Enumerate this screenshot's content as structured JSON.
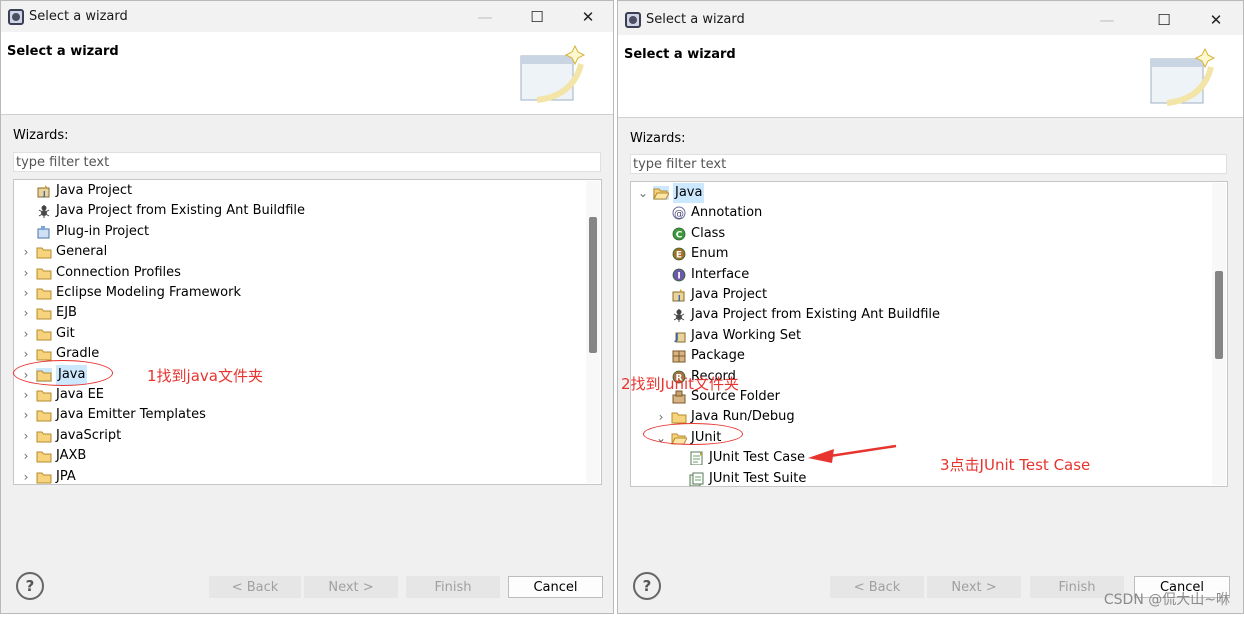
{
  "dialogs": [
    {
      "window_title": "Select a wizard",
      "header_title": "Select a wizard",
      "wizards_label": "Wizards:",
      "filter_placeholder": "type filter text",
      "buttons": {
        "back": "< Back",
        "next": "Next >",
        "finish": "Finish",
        "cancel": "Cancel"
      },
      "help": "?",
      "tree": [
        {
          "label": "Java Project",
          "icon": "java-project-icon",
          "level": 1,
          "expander": ""
        },
        {
          "label": "Java Project from Existing Ant Buildfile",
          "icon": "ant-icon",
          "level": 1,
          "expander": ""
        },
        {
          "label": "Plug-in Project",
          "icon": "plugin-project-icon",
          "level": 1,
          "expander": ""
        },
        {
          "label": "General",
          "icon": "folder-icon",
          "level": 0,
          "expander": "›"
        },
        {
          "label": "Connection Profiles",
          "icon": "folder-icon",
          "level": 0,
          "expander": "›"
        },
        {
          "label": "Eclipse Modeling Framework",
          "icon": "folder-icon",
          "level": 0,
          "expander": "›"
        },
        {
          "label": "EJB",
          "icon": "folder-icon",
          "level": 0,
          "expander": "›"
        },
        {
          "label": "Git",
          "icon": "folder-icon",
          "level": 0,
          "expander": "›"
        },
        {
          "label": "Gradle",
          "icon": "folder-icon",
          "level": 0,
          "expander": "›"
        },
        {
          "label": "Java",
          "icon": "folder-icon",
          "level": 0,
          "expander": "›",
          "selected": true
        },
        {
          "label": "Java EE",
          "icon": "folder-icon",
          "level": 0,
          "expander": "›"
        },
        {
          "label": "Java Emitter Templates",
          "icon": "folder-icon",
          "level": 0,
          "expander": "›"
        },
        {
          "label": "JavaScript",
          "icon": "folder-icon",
          "level": 0,
          "expander": "›"
        },
        {
          "label": "JAXB",
          "icon": "folder-icon",
          "level": 0,
          "expander": "›"
        },
        {
          "label": "JPA",
          "icon": "folder-icon",
          "level": 0,
          "expander": "›"
        }
      ],
      "annotation": "1找到java文件夹"
    },
    {
      "window_title": "Select a wizard",
      "header_title": "Select a wizard",
      "wizards_label": "Wizards:",
      "filter_placeholder": "type filter text",
      "buttons": {
        "back": "< Back",
        "next": "Next >",
        "finish": "Finish",
        "cancel": "Cancel"
      },
      "help": "?",
      "tree": [
        {
          "label": "Java",
          "icon": "folder-open-icon",
          "level": 0,
          "expander": "⌄",
          "selected": true
        },
        {
          "label": "Annotation",
          "icon": "annotation-icon",
          "level": 1,
          "expander": ""
        },
        {
          "label": "Class",
          "icon": "class-icon",
          "level": 1,
          "expander": ""
        },
        {
          "label": "Enum",
          "icon": "enum-icon",
          "level": 1,
          "expander": ""
        },
        {
          "label": "Interface",
          "icon": "interface-icon",
          "level": 1,
          "expander": ""
        },
        {
          "label": "Java Project",
          "icon": "java-project-icon",
          "level": 1,
          "expander": ""
        },
        {
          "label": "Java Project from Existing Ant Buildfile",
          "icon": "ant-icon",
          "level": 1,
          "expander": ""
        },
        {
          "label": "Java Working Set",
          "icon": "working-set-icon",
          "level": 1,
          "expander": ""
        },
        {
          "label": "Package",
          "icon": "package-icon",
          "level": 1,
          "expander": ""
        },
        {
          "label": "Record",
          "icon": "record-icon",
          "level": 1,
          "expander": ""
        },
        {
          "label": "Source Folder",
          "icon": "source-folder-icon",
          "level": 1,
          "expander": ""
        },
        {
          "label": "Java Run/Debug",
          "icon": "folder-icon",
          "level": 1,
          "expander": "›"
        },
        {
          "label": "JUnit",
          "icon": "folder-open-icon",
          "level": 1,
          "expander": "⌄"
        },
        {
          "label": "JUnit Test Case",
          "icon": "junit-test-case-icon",
          "level": 2,
          "expander": ""
        },
        {
          "label": "JUnit Test Suite",
          "icon": "junit-test-suite-icon",
          "level": 2,
          "expander": ""
        }
      ],
      "annotation_2": "2找到Junit文件夹",
      "annotation_3": "3点击JUnit Test Case"
    }
  ],
  "watermark": "CSDN @侃大山~咻",
  "colors": {
    "annotation": "#e8342f",
    "selection": "#cce8ff"
  }
}
